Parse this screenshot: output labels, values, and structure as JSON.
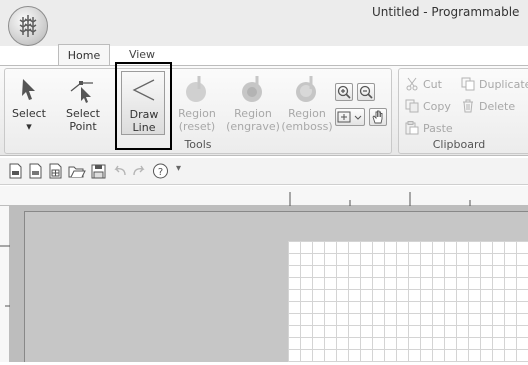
{
  "window": {
    "title": "Untitled - Programmable"
  },
  "tabs": [
    {
      "label": "Home"
    },
    {
      "label": "View"
    }
  ],
  "tools": {
    "label": "Tools",
    "buttons": [
      {
        "line1": "Select",
        "line2": "▾"
      },
      {
        "line1": "Select",
        "line2": "Point"
      },
      {
        "line1": "Draw",
        "line2": "Line"
      },
      {
        "line1": "Region",
        "line2": "(reset)"
      },
      {
        "line1": "Region",
        "line2": "(engrave)"
      },
      {
        "line1": "Region",
        "line2": "(emboss)"
      }
    ]
  },
  "clipboard": {
    "label": "Clipboard",
    "cut": "Cut",
    "copy": "Copy",
    "paste": "Paste",
    "duplicate": "Duplicate",
    "delete": "Delete"
  },
  "qat": {
    "more": "▾"
  },
  "colors": {
    "highlight": "#000000",
    "accent": "#3b6ea5"
  }
}
